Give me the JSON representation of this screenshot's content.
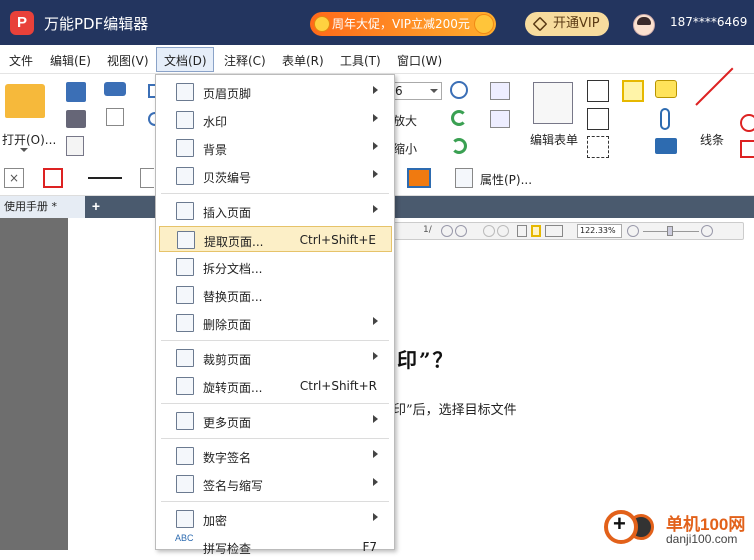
{
  "app": {
    "title": "万能PDF编辑器",
    "logo_letter": "P",
    "promo": "周年大促，VIP立减200元",
    "vip_button": "开通VIP",
    "user": "187****6469"
  },
  "menubar": [
    "文件",
    "编辑(E)",
    "视图(V)",
    "文档(D)",
    "注释(C)",
    "表单(R)",
    "工具(T)",
    "窗口(W)"
  ],
  "ribbon": {
    "open_label": "打开(O)...",
    "zoom_in": "放大",
    "zoom_out": "缩小",
    "edit_form": "编辑表单",
    "line_label": "线条",
    "zoom_value_partial": "6",
    "properties": "属性(P)..."
  },
  "tab": {
    "label": "使用手册 *",
    "add": "+"
  },
  "doc_toolbar": {
    "page": "1/",
    "zoom": "122.33%"
  },
  "document": {
    "heading": "印”？",
    "paragraph": "印”后，选择目标文件"
  },
  "dropdown": [
    {
      "label": "页眉页脚",
      "submenu": true
    },
    {
      "label": "水印",
      "submenu": true
    },
    {
      "label": "背景",
      "submenu": true
    },
    {
      "label": "贝茨编号",
      "submenu": true
    },
    {
      "label": "插入页面",
      "submenu": true
    },
    {
      "label": "提取页面...",
      "shortcut": "Ctrl+Shift+E",
      "highlighted": true
    },
    {
      "label": "拆分文档...",
      "submenu": false
    },
    {
      "label": "替换页面...",
      "submenu": false
    },
    {
      "label": "删除页面",
      "submenu": true
    },
    {
      "label": "裁剪页面",
      "submenu": true
    },
    {
      "label": "旋转页面...",
      "shortcut": "Ctrl+Shift+R"
    },
    {
      "label": "更多页面",
      "submenu": true
    },
    {
      "label": "数字签名",
      "submenu": true
    },
    {
      "label": "签名与缩写",
      "submenu": true
    },
    {
      "label": "加密",
      "submenu": true
    },
    {
      "label": "拼写检查",
      "shortcut": "F7",
      "icon_text": "ABC"
    }
  ],
  "watermark": {
    "brand": "单机100网",
    "url": "danji100.com"
  },
  "colors": {
    "titlebar": "#23355f",
    "accent_orange": "#e2611a",
    "highlight": "#fcefc7"
  }
}
